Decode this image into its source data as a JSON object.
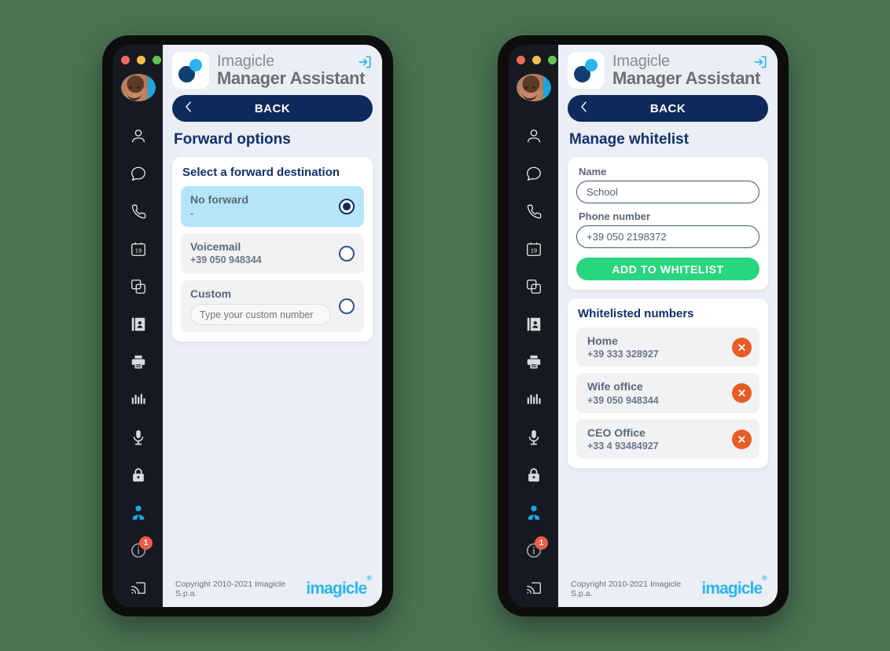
{
  "window": {
    "traffic_lights": [
      "close",
      "minimize",
      "maximize"
    ],
    "background_color": "#4a7352",
    "frame_color": "#0d0d0d"
  },
  "sidebar": {
    "avatar_name": "user-avatar",
    "items": [
      {
        "icon": "person-icon",
        "name": "sidebar-item-contacts",
        "active": false
      },
      {
        "icon": "chat-bubble-icon",
        "name": "sidebar-item-chat",
        "active": false
      },
      {
        "icon": "phone-icon",
        "name": "sidebar-item-calls",
        "active": false
      },
      {
        "icon": "calendar-19-icon",
        "name": "sidebar-item-calendar",
        "active": false,
        "day": "19"
      },
      {
        "icon": "copy-icon",
        "name": "sidebar-item-duplicate",
        "active": false
      },
      {
        "icon": "address-book-icon",
        "name": "sidebar-item-directory",
        "active": false
      },
      {
        "icon": "printer-icon",
        "name": "sidebar-item-fax",
        "active": false
      },
      {
        "icon": "bar-chart-icon",
        "name": "sidebar-item-analytics",
        "active": false
      },
      {
        "icon": "microphone-icon",
        "name": "sidebar-item-recording",
        "active": false
      },
      {
        "icon": "lock-icon",
        "name": "sidebar-item-security",
        "active": false
      },
      {
        "icon": "manager-icon",
        "name": "sidebar-item-manager",
        "active": true
      },
      {
        "icon": "info-icon",
        "name": "sidebar-item-info",
        "active": false,
        "badge": "1"
      },
      {
        "icon": "cast-icon",
        "name": "sidebar-item-cast",
        "active": false
      }
    ],
    "active_color": "#1ca5e0",
    "badge_color": "#ef5b4c"
  },
  "header": {
    "logo_name": "imagicle-logo",
    "brand_line1": "Imagicle",
    "brand_line2": "Manager Assistant",
    "logout_icon": "logout-icon"
  },
  "footer": {
    "copyright": "Copyright 2010-2021 Imagicle S.p.a.",
    "watermark": "imagicle",
    "watermark_color": "#29b5ee"
  },
  "screens": [
    {
      "id": "forward-options",
      "back_label": "BACK",
      "title": "Forward options",
      "card_title": "Select a forward destination",
      "options": [
        {
          "name": "No forward",
          "detail": "-",
          "selected": true,
          "input": null
        },
        {
          "name": "Voicemail",
          "detail": "+39 050 948344",
          "selected": false,
          "input": null
        },
        {
          "name": "Custom",
          "detail": null,
          "selected": false,
          "input": {
            "value": "",
            "placeholder": "Type your custom number"
          }
        }
      ]
    },
    {
      "id": "manage-whitelist",
      "back_label": "BACK",
      "title": "Manage whitelist",
      "form": {
        "name_label": "Name",
        "name_value": "School",
        "name_placeholder": "Name",
        "phone_label": "Phone number",
        "phone_value": "+39 050 2198372",
        "phone_placeholder": "Phone number",
        "submit_label": "ADD TO WHITELIST",
        "submit_color": "#2ad57f"
      },
      "list_title": "Whitelisted numbers",
      "entries": [
        {
          "name": "Home",
          "number": "+39 333 328927"
        },
        {
          "name": "Wife office",
          "number": "+39 050 948344"
        },
        {
          "name": "CEO Office",
          "number": "+33 4 93484927"
        }
      ],
      "delete_color": "#ea5c25"
    }
  ]
}
